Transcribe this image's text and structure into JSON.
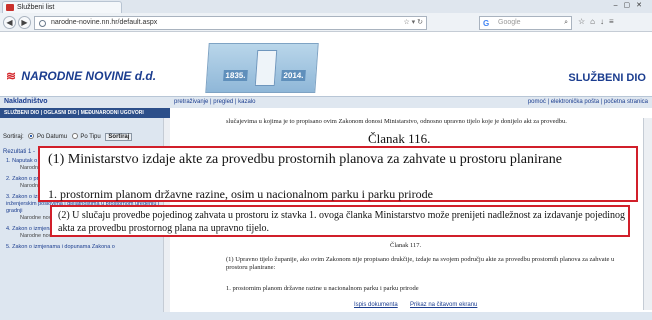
{
  "browser": {
    "tab_title": "Službeni list",
    "url": "narodne-novine.nn.hr/default.aspx",
    "search_placeholder": "Google",
    "search_engine_letter": "G"
  },
  "header": {
    "logo_text": "NARODNE NOVINE",
    "logo_suffix": "d.d.",
    "banner_year_start": "1835.",
    "banner_year_end": "2014.",
    "section_title": "SLUŽBENI DIO"
  },
  "sitenav": {
    "left_title": "Nakladništvo",
    "links_left": "pretraživanje  |  pregled  |  kazalo",
    "links_right": "pomoć  |  elektronička pošta  |  početna stranica",
    "subnav": "SLUŽBENI DIO | OGLASNI DIO | MEĐUNARODNI UGOVORI"
  },
  "sidebar": {
    "sort_label": "Sortiraj:",
    "sort_opt1": "Po Datumu",
    "sort_opt2": "Po Tipu",
    "sort_button": "Sortiraj",
    "results_label": "Rezultati 1 -",
    "results": [
      {
        "title": "1. Naputak o ... akata na for... elektroničk...",
        "sub": "Narodne novine br.: 07.05.2014."
      },
      {
        "title": "2. Zakon o prostornom uređenju",
        "sub": "Narodne novine br.: 18.12.2013."
      },
      {
        "title": "3. Zakon o izmjenama i dopunama Zakona o arhitektonskim i inženjerskim poslovima i djelatnostima u prostornom uređenju i gradnji",
        "sub": "Narodne novine br.: 25 28.02.2013."
      },
      {
        "title": "4. Zakon o izmjenama Zakona o prostornom uređenju i gradnji",
        "sub": "Narodne novine br.: 50 02.05.2012."
      },
      {
        "title": "5. Zakon o izmjenama i dopunama Zakona o",
        "sub": ""
      }
    ]
  },
  "document": {
    "top_text": "slučajevima u kojima je to propisano ovim Zakonom donosi Ministarstvo, odnosno upravno tijelo koje je donijelo akt za provedbu.",
    "clanak_116": "Članak 116.",
    "box1_line1": "(1) Ministarstvo izdaje akte za provedbu prostornih planova za zahvate u prostoru planirane",
    "box1_line2": "1. prostornim planom državne razine, osim u nacionalnom parku i parku prirode",
    "box2_text": "(2) U slučaju provedbe pojedinog zahvata u prostoru iz stavka 1. ovoga članka Ministarstvo može prenijeti nadležnost za izdavanje pojedinog akta za provedbu prostornog plana na upravno tijelo.",
    "clanak_117": "Članak 117.",
    "body_117": "(1) Upravno tijelo županije, ako ovim Zakonom nije propisano drukčije, izdaje na svojem području akte za provedbu prostornih planova za zahvate u prostoru planirane:",
    "bullet_117": "1. prostornim planom državne razine u nacionalnom parku i parku prirode"
  },
  "footer": {
    "print_link": "Ispis dokumenta",
    "screen_link": "Prikaz na čitavom ekranu"
  }
}
